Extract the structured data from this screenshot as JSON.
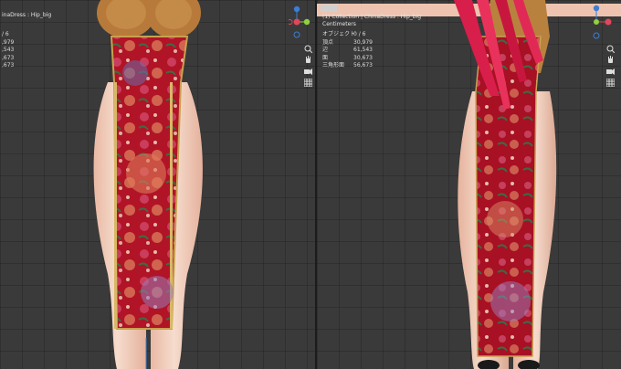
{
  "left_viewport": {
    "header_text": "inaDress : Hip_big",
    "stats": [
      {
        "label": "",
        "value": "/ 6"
      },
      {
        "label": "",
        "value": ",979"
      },
      {
        "label": "",
        "value": ",543"
      },
      {
        "label": "",
        "value": ",673"
      },
      {
        "label": "",
        "value": ",673"
      }
    ]
  },
  "right_viewport": {
    "header_text": "(1) Collection | ChinaDress : Hip_big",
    "unit_label": "Centimeters",
    "stats": [
      {
        "label": "オブジェクト",
        "value": "0 / 6"
      },
      {
        "label": "頂点",
        "value": "30,979"
      },
      {
        "label": "辺",
        "value": "61,543"
      },
      {
        "label": "面",
        "value": "30,673"
      },
      {
        "label": "三角形面",
        "value": "56,673"
      }
    ]
  },
  "gizmo": {
    "axes": [
      "Z",
      "Y",
      "X"
    ],
    "colors": {
      "x": "#e0475a",
      "y": "#8fd13f",
      "z": "#3b7ed6"
    }
  },
  "tools": [
    "zoom-icon",
    "hand-pan-icon",
    "camera-icon",
    "grid-icon"
  ],
  "colors": {
    "viewport_bg": "#3a3a3a",
    "skin": "#f1cdbb",
    "dress_red": "#b3142a",
    "hair": "#d81e4a"
  }
}
